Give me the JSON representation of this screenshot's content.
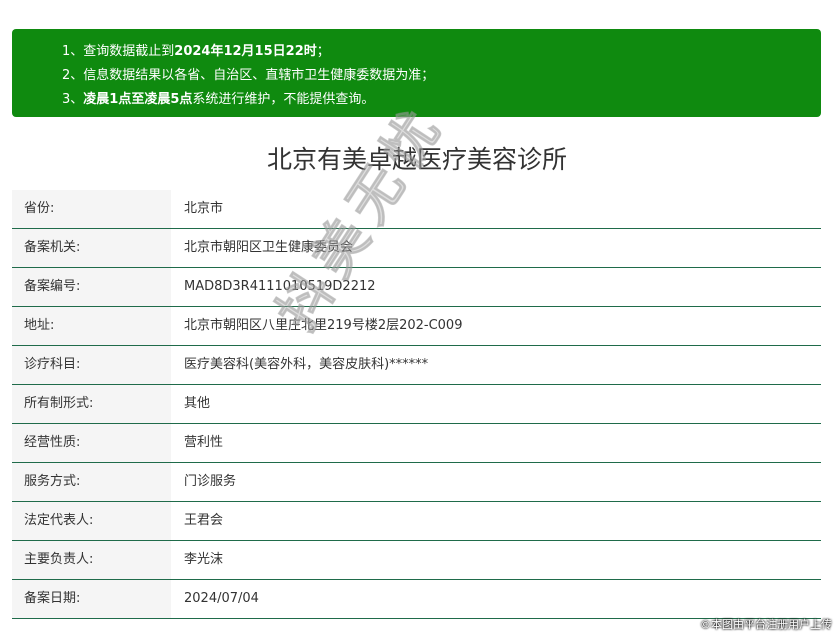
{
  "notice": {
    "line1_prefix": "1、查询数据截止到",
    "line1_bold": "2024年12月15日22时",
    "line1_suffix": "；",
    "line2": "2、信息数据结果以各省、自治区、直辖市卫生健康委数据为准；",
    "line3_prefix": "3、",
    "line3_bold1": "凌晨1点",
    "line3_mid": "至",
    "line3_bold2": "凌晨5点",
    "line3_suffix": "系统进行维护，不能提供查询。",
    "background_color": "#0f8a0f"
  },
  "page_title": "北京有美卓越医疗美容诊所",
  "rows": [
    {
      "label": "省份:",
      "value": "北京市"
    },
    {
      "label": "备案机关:",
      "value": "北京市朝阳区卫生健康委员会"
    },
    {
      "label": "备案编号:",
      "value": "MAD8D3R4111010519D2212"
    },
    {
      "label": "地址:",
      "value": "北京市朝阳区八里庄北里219号楼2层202-C009"
    },
    {
      "label": "诊疗科目:",
      "value": "医疗美容科(美容外科，美容皮肤科)******"
    },
    {
      "label": "所有制形式:",
      "value": "其他"
    },
    {
      "label": "经营性质:",
      "value": "营利性"
    },
    {
      "label": "服务方式:",
      "value": "门诊服务"
    },
    {
      "label": "法定代表人:",
      "value": "王君会"
    },
    {
      "label": "主要负责人:",
      "value": "李光沫"
    },
    {
      "label": "备案日期:",
      "value": "2024/07/04"
    }
  ],
  "watermark": "抖美无忧",
  "credit": "©本图由平台注册用户上传",
  "row_border_color": "#1f6b4a"
}
